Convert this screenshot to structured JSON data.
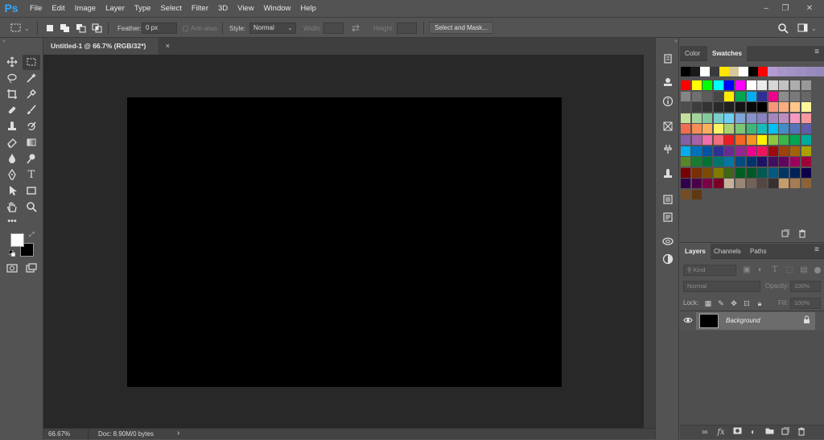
{
  "app": {
    "logo": "Ps"
  },
  "menu": [
    "File",
    "Edit",
    "Image",
    "Layer",
    "Type",
    "Select",
    "Filter",
    "3D",
    "View",
    "Window",
    "Help"
  ],
  "window_controls": {
    "minimize": "‒",
    "restore": "❐",
    "close": "✕"
  },
  "options": {
    "feather_label": "Feather:",
    "feather_value": "0 px",
    "anti_alias": "Anti-alias",
    "style_label": "Style:",
    "style_value": "Normal",
    "width_label": "Width:",
    "height_label": "Height:",
    "select_mask": "Select and Mask..."
  },
  "document": {
    "tab_title": "Untitled-1 @ 66.7% (RGB/32*)",
    "close": "×",
    "canvas_color": "#000000"
  },
  "status": {
    "zoom": "66.67%",
    "doc": "Doc: 8.90M/0 bytes",
    "arrow": "›"
  },
  "color_panel": {
    "tabs": [
      "Color",
      "Swatches"
    ],
    "active": "Swatches"
  },
  "swatches": {
    "row0": [
      "#000000",
      "#1a1a1a",
      "#ffffff",
      "#3a3a3a",
      "#ffe500",
      "#d7c89c",
      "#ffffff",
      "#000000",
      "#ff0000",
      "#b39ad1",
      "#a996c9",
      "#a393c5",
      "#9e8fc1",
      "#998bbd",
      "#9688ba"
    ],
    "rows": [
      [
        "#ff0000",
        "#ffff00",
        "#00ff00",
        "#00ffff",
        "#0000ff",
        "#ff00ff",
        "#ffffff",
        "#ebebeb",
        "#d6d6d6",
        "#c2c2c2",
        "#adadad",
        "#999999"
      ],
      [
        "#858585",
        "#707070",
        "#5c5c5c",
        "#474747",
        "#ffec00",
        "#00a651",
        "#00aeef",
        "#2e3192",
        "#ec008c",
        "#8c8c8c",
        "#7a7a7a",
        "#666666"
      ],
      [
        "#4d4d4d",
        "#3d3d3d",
        "#333333",
        "#292929",
        "#1f1f1f",
        "#141414",
        "#0a0a0a",
        "#000000",
        "#f7977a",
        "#f9ad81",
        "#fdc68a",
        "#fff79a"
      ],
      [
        "#c4df9b",
        "#a2d39c",
        "#82ca9d",
        "#7bcdc8",
        "#6ecff6",
        "#7ea7d8",
        "#8493ca",
        "#8882be",
        "#a187be",
        "#bc8dbf",
        "#f49ac2",
        "#f6989d"
      ],
      [
        "#f26c4f",
        "#f68e55",
        "#fbaf5c",
        "#fff467",
        "#acd372",
        "#7cc576",
        "#3bb878",
        "#1abbb4",
        "#00bff3",
        "#438cca",
        "#5574b9",
        "#605ca8"
      ],
      [
        "#855fa8",
        "#a763a8",
        "#f06ea9",
        "#f26d7d",
        "#ed1c24",
        "#f26522",
        "#f7941d",
        "#fff200",
        "#8dc63f",
        "#39b54a",
        "#00a651",
        "#00a99d"
      ],
      [
        "#00aeef",
        "#0072bc",
        "#0054a6",
        "#2e3192",
        "#662d91",
        "#92278f",
        "#ec008c",
        "#ed145b",
        "#9e0b0f",
        "#a0410d",
        "#a36209",
        "#aba000"
      ],
      [
        "#598527",
        "#1a7b30",
        "#007236",
        "#00746b",
        "#0076a3",
        "#004b80",
        "#003471",
        "#1b1464",
        "#440e62",
        "#630460",
        "#9e005d",
        "#9e0039"
      ],
      [
        "#790000",
        "#7b2e00",
        "#7d4900",
        "#827b00",
        "#406618",
        "#005e20",
        "#005826",
        "#005952",
        "#005b7f",
        "#003663",
        "#002157",
        "#0d004c"
      ],
      [
        "#32004b",
        "#4b0049",
        "#7b0046",
        "#7a0026",
        "#c7b299",
        "#998675",
        "#736357",
        "#534741",
        "#37302d",
        "#c69c6d",
        "#a67c52",
        "#8c6239"
      ],
      [
        "#754c24",
        "#603913"
      ]
    ]
  },
  "layers_panel": {
    "tabs": [
      "Layers",
      "Channels",
      "Paths"
    ],
    "active": "Layers",
    "filter_placeholder": "Kind",
    "blend": "Normal",
    "opacity_label": "Opacity:",
    "opacity_value": "100%",
    "lock_label": "Lock:",
    "fill_label": "Fill:",
    "fill_value": "100%",
    "layer_name": "Background"
  }
}
